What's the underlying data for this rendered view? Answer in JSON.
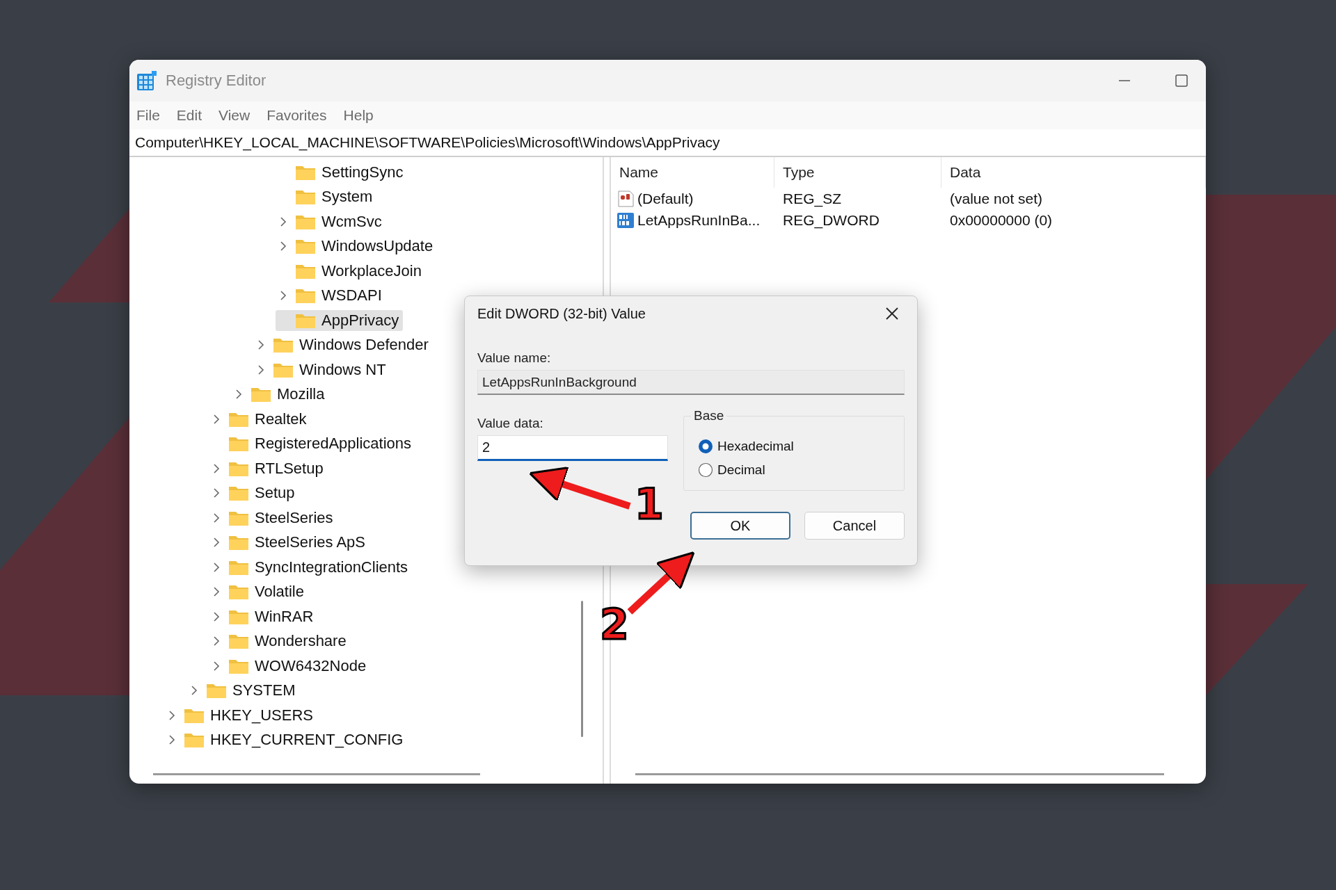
{
  "window": {
    "title": "Registry Editor",
    "controls": [
      {
        "kind": "minimize"
      },
      {
        "kind": "maximize"
      }
    ]
  },
  "menu": [
    "File",
    "Edit",
    "View",
    "Favorites",
    "Help"
  ],
  "address": "Computer\\HKEY_LOCAL_MACHINE\\SOFTWARE\\Policies\\Microsoft\\Windows\\AppPrivacy",
  "tree": [
    {
      "children": [
        {
          "children": [
            {
              "children": [
                {
                  "children": [
                    {
                      "children": [
                        {
                          "children": [
                            {
                              "label": "SettingSync",
                              "has_children": false,
                              "selected": false
                            },
                            {
                              "label": "System",
                              "has_children": false,
                              "selected": false
                            },
                            {
                              "label": "WcmSvc",
                              "has_children": true,
                              "selected": false
                            },
                            {
                              "label": "WindowsUpdate",
                              "has_children": true,
                              "selected": false
                            },
                            {
                              "label": "WorkplaceJoin",
                              "has_children": false,
                              "selected": false
                            },
                            {
                              "label": "WSDAPI",
                              "has_children": true,
                              "selected": false
                            },
                            {
                              "label": "AppPrivacy",
                              "has_children": false,
                              "selected": true
                            }
                          ]
                        },
                        {
                          "label": "Windows Defender",
                          "has_children": true,
                          "selected": false
                        },
                        {
                          "label": "Windows NT",
                          "has_children": true,
                          "selected": false
                        }
                      ]
                    },
                    {
                      "label": "Mozilla",
                      "has_children": true,
                      "selected": false
                    }
                  ]
                },
                {
                  "label": "Realtek",
                  "has_children": true,
                  "selected": false
                },
                {
                  "label": "RegisteredApplications",
                  "has_children": false,
                  "selected": false
                },
                {
                  "label": "RTLSetup",
                  "has_children": true,
                  "selected": false
                },
                {
                  "label": "Setup",
                  "has_children": true,
                  "selected": false
                },
                {
                  "label": "SteelSeries",
                  "has_children": true,
                  "selected": false
                },
                {
                  "label": "SteelSeries ApS",
                  "has_children": true,
                  "selected": false
                },
                {
                  "label": "SyncIntegrationClients",
                  "has_children": true,
                  "selected": false
                },
                {
                  "label": "Volatile",
                  "has_children": true,
                  "selected": false
                },
                {
                  "label": "WinRAR",
                  "has_children": true,
                  "selected": false
                },
                {
                  "label": "Wondershare",
                  "has_children": true,
                  "selected": false
                },
                {
                  "label": "WOW6432Node",
                  "has_children": true,
                  "selected": false
                }
              ]
            },
            {
              "label": "SYSTEM",
              "has_children": true,
              "selected": false
            }
          ]
        },
        {
          "label": "HKEY_USERS",
          "has_children": true,
          "selected": false
        },
        {
          "label": "HKEY_CURRENT_CONFIG",
          "has_children": true,
          "selected": false
        }
      ]
    }
  ],
  "values": {
    "columns": [
      "Name",
      "Type",
      "Data"
    ],
    "rows": [
      {
        "kind": "string",
        "name": "(Default)",
        "type": "REG_SZ",
        "data": "(value not set)"
      },
      {
        "kind": "binary",
        "name": "LetAppsRunInBa...",
        "type": "REG_DWORD",
        "data": "0x00000000 (0)"
      }
    ]
  },
  "dialog": {
    "title": "Edit DWORD (32-bit) Value",
    "value_name_label": "Value name:",
    "value_name": "LetAppsRunInBackground",
    "value_data_label": "Value data:",
    "value_data": "2",
    "base_label": "Base",
    "bases": [
      {
        "label": "Hexadecimal",
        "selected": true
      },
      {
        "label": "Decimal",
        "selected": false
      }
    ],
    "buttons": [
      {
        "label": "OK",
        "default": true
      },
      {
        "label": "Cancel",
        "default": false
      }
    ]
  },
  "annotations": [
    {
      "label": "1"
    },
    {
      "label": "2"
    }
  ]
}
